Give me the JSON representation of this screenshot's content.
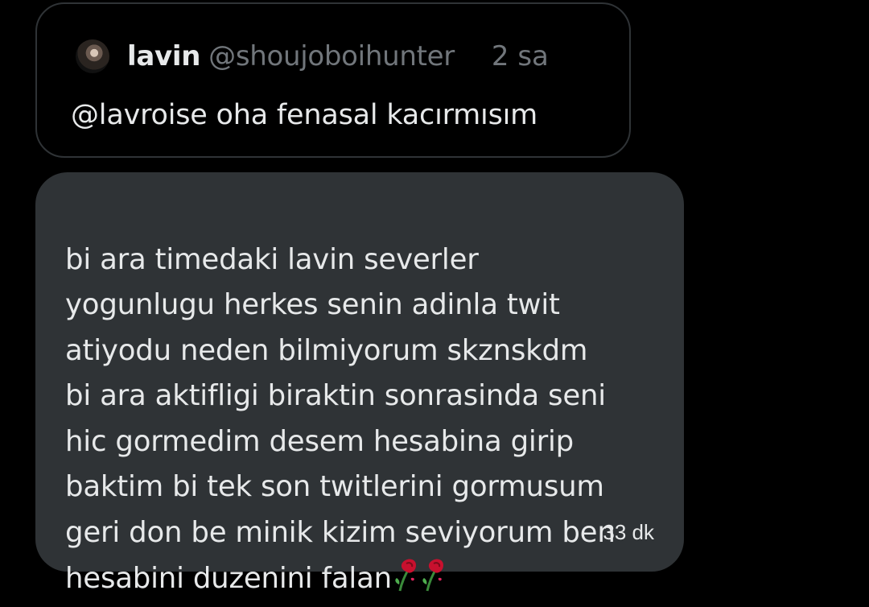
{
  "quoted_post": {
    "display_name": "lavin",
    "handle": "@shoujoboihunter",
    "time": "2 sa",
    "text": "@lavroise oha fenasal kacırmısım"
  },
  "message": {
    "lines": [
      "bi ara timedaki lavin severler",
      "yogunlugu herkes senin adinla twit",
      "atiyodu neden bilmiyorum skznskdm",
      "bi ara aktifligi biraktin sonrasinda seni",
      "hic gormedim desem hesabina girip",
      "baktim bi tek son twitlerini gormusum",
      "geri don be minik kizim seviyorum ben",
      "hesabini duzenini falan"
    ],
    "emojis": [
      "wilted-rose-icon",
      "wilted-rose-icon"
    ],
    "time": "33 dk"
  },
  "colors": {
    "background": "#000000",
    "bubble": "#2f3336",
    "text": "#e7e9ea",
    "muted": "#71767b",
    "rose": "#e0245e"
  }
}
